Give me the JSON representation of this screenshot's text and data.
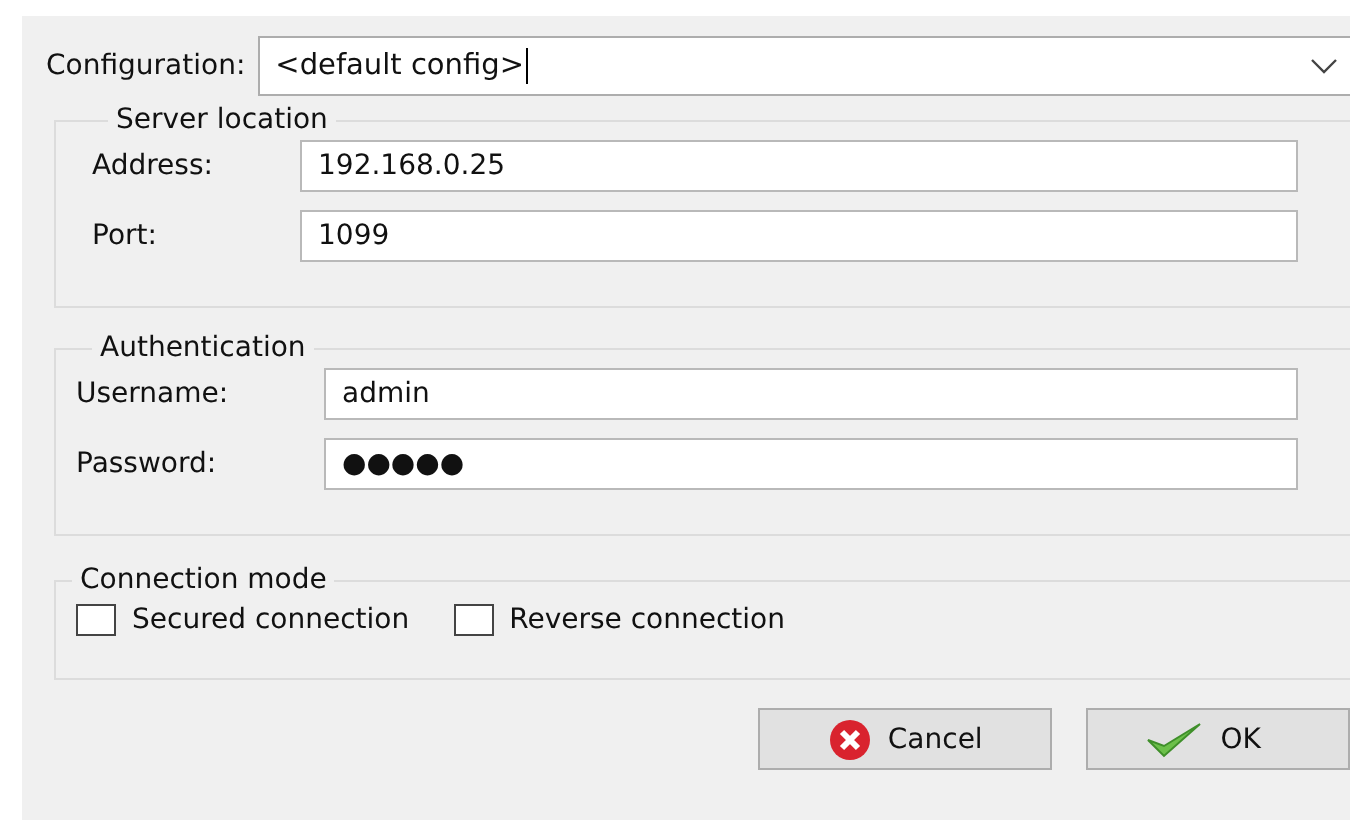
{
  "configuration": {
    "label": "Configuration:",
    "value": "<default config>"
  },
  "server_location": {
    "title": "Server location",
    "fields": [
      {
        "label": "Address:",
        "value": "192.168.0.25"
      },
      {
        "label": "Port:",
        "value": "1099"
      }
    ]
  },
  "authentication": {
    "title": "Authentication",
    "fields": [
      {
        "label": "Username:",
        "value": "admin"
      },
      {
        "label": "Password:",
        "value": "●●●●●"
      }
    ]
  },
  "connection_mode": {
    "title": "Connection mode",
    "options": [
      {
        "label": "Secured connection",
        "checked": false
      },
      {
        "label": "Reverse connection",
        "checked": false
      }
    ]
  },
  "buttons": [
    {
      "label": "Cancel",
      "kind": "cancel"
    },
    {
      "label": "OK",
      "kind": "ok"
    }
  ]
}
